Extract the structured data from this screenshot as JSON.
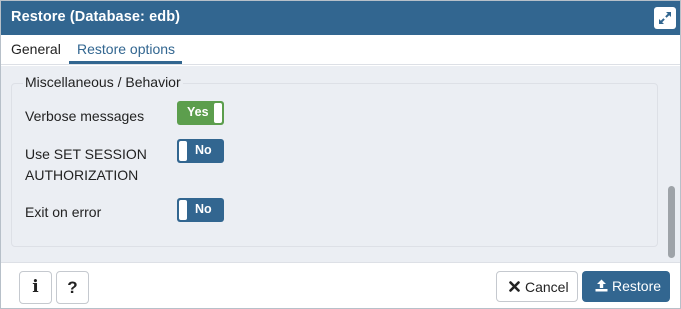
{
  "dialog": {
    "title": "Restore (Database: edb)",
    "maximize_icon": "expand-icon"
  },
  "tabs": [
    {
      "label": "General",
      "active": false
    },
    {
      "label": "Restore options",
      "active": true
    }
  ],
  "section": {
    "legend": "Miscellaneous / Behavior",
    "fields": [
      {
        "label": "Verbose messages",
        "value": "Yes",
        "on": true
      },
      {
        "label_line1": "Use SET SESSION",
        "label_line2": "AUTHORIZATION",
        "value": "No",
        "on": false
      },
      {
        "label": "Exit on error",
        "value": "No",
        "on": false
      }
    ]
  },
  "footer": {
    "info_label": "i",
    "help_label": "?",
    "cancel_label": "Cancel",
    "cancel_icon": "close-icon",
    "restore_label": "Restore",
    "restore_icon": "upload-icon"
  },
  "colors": {
    "titlebar": "#326690",
    "accent": "#326690",
    "toggle_on": "#5c9e4d",
    "toggle_off": "#326690",
    "panel_bg": "#ebeef3"
  }
}
